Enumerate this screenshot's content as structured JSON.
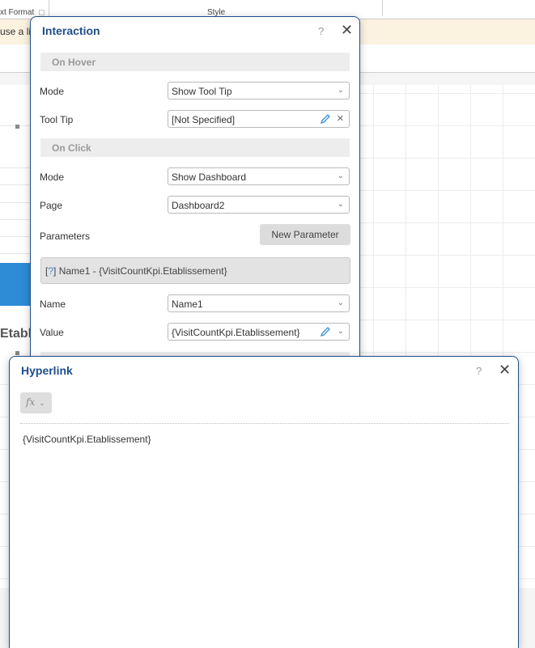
{
  "background": {
    "ribbon": {
      "group_labels": [
        "xt Format",
        "Style"
      ]
    },
    "license_text": "use a lic",
    "canvas_title": "Etabli"
  },
  "interaction_dialog": {
    "title": "Interaction",
    "help_icon": "?",
    "close_icon": "✕",
    "on_hover": {
      "heading": "On Hover",
      "mode_label": "Mode",
      "mode_value": "Show Tool Tip",
      "tooltip_label": "Tool Tip",
      "tooltip_value": "[Not Specified]"
    },
    "on_click": {
      "heading": "On Click",
      "mode_label": "Mode",
      "mode_value": "Show Dashboard",
      "page_label": "Page",
      "page_value": "Dashboard2",
      "parameters_label": "Parameters",
      "new_parameter_button": "New Parameter",
      "parameters": [
        {
          "marker": "?",
          "text": "Name1 - {VisitCountKpi.Etablissement}"
        }
      ],
      "name_label": "Name",
      "name_value": "Name1",
      "value_label": "Value",
      "value_value": "{VisitCountKpi.Etablissement}"
    }
  },
  "hyperlink_dialog": {
    "title": "Hyperlink",
    "help_icon": "?",
    "close_icon": "✕",
    "fx_button": "fx",
    "expression": "{VisitCountKpi.Etablissement}"
  },
  "colors": {
    "dialog_border": "#1f4e8c",
    "title": "#1f4e8c",
    "accent_blue": "#2e8bd6",
    "license_bar": "#fbf2e0"
  }
}
